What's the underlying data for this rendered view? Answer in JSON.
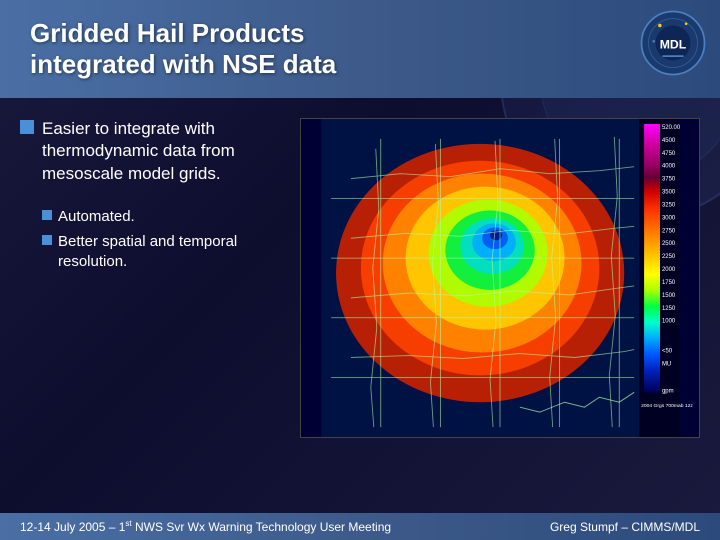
{
  "header": {
    "title_line1": "Gridded Hail Products",
    "title_line2": "integrated with NSE data"
  },
  "main_bullet": {
    "text": "Easier to integrate with thermodynamic data from mesoscale model grids."
  },
  "sub_bullets": [
    {
      "text": "Automated."
    },
    {
      "text": "Better spatial and temporal resolution."
    }
  ],
  "legend": {
    "labels": [
      "520.00",
      "4500",
      "4750",
      "4000",
      "3750",
      "3500",
      "3250",
      "3000",
      "2750",
      "2500",
      "2250",
      "2000",
      "1750",
      "1500",
      "1250",
      "1000",
      "<50",
      "MU",
      "",
      "gpm"
    ]
  },
  "footer": {
    "left": "12-14 July 2005 – 1st NWS Svr Wx Warning Technology User Meeting",
    "right": "Greg Stumpf – CIMMS/MDL"
  },
  "logo": {
    "text": "MDL"
  }
}
